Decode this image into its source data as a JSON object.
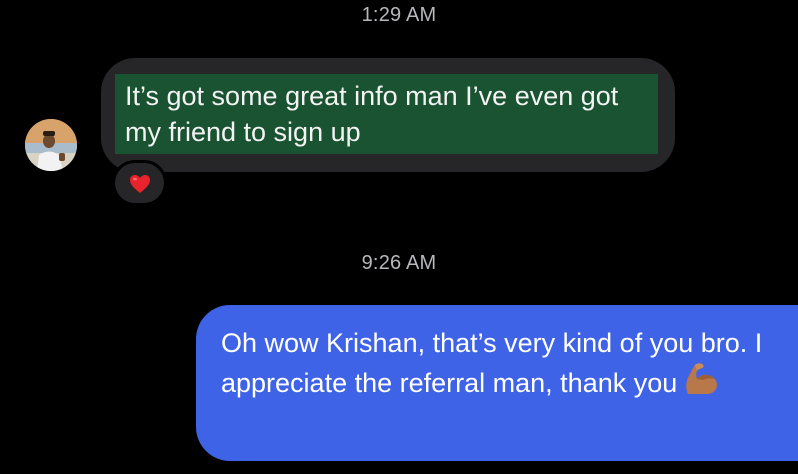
{
  "conversation": {
    "timestamps": [
      "1:29 AM",
      "9:26 AM"
    ],
    "incoming_message": {
      "text": "It’s got some great info man I’ve even got my friend to sign up",
      "highlight_color": "#1a5331",
      "bubble_color": "#262628",
      "reaction_icon": "red-heart-icon"
    },
    "outgoing_message": {
      "text": "Oh wow Krishan, that’s very kind of you bro. I appreciate the referral man, thank you",
      "emoji_icon": "flexed-biceps-icon",
      "bubble_color": "#3f63e6"
    }
  }
}
